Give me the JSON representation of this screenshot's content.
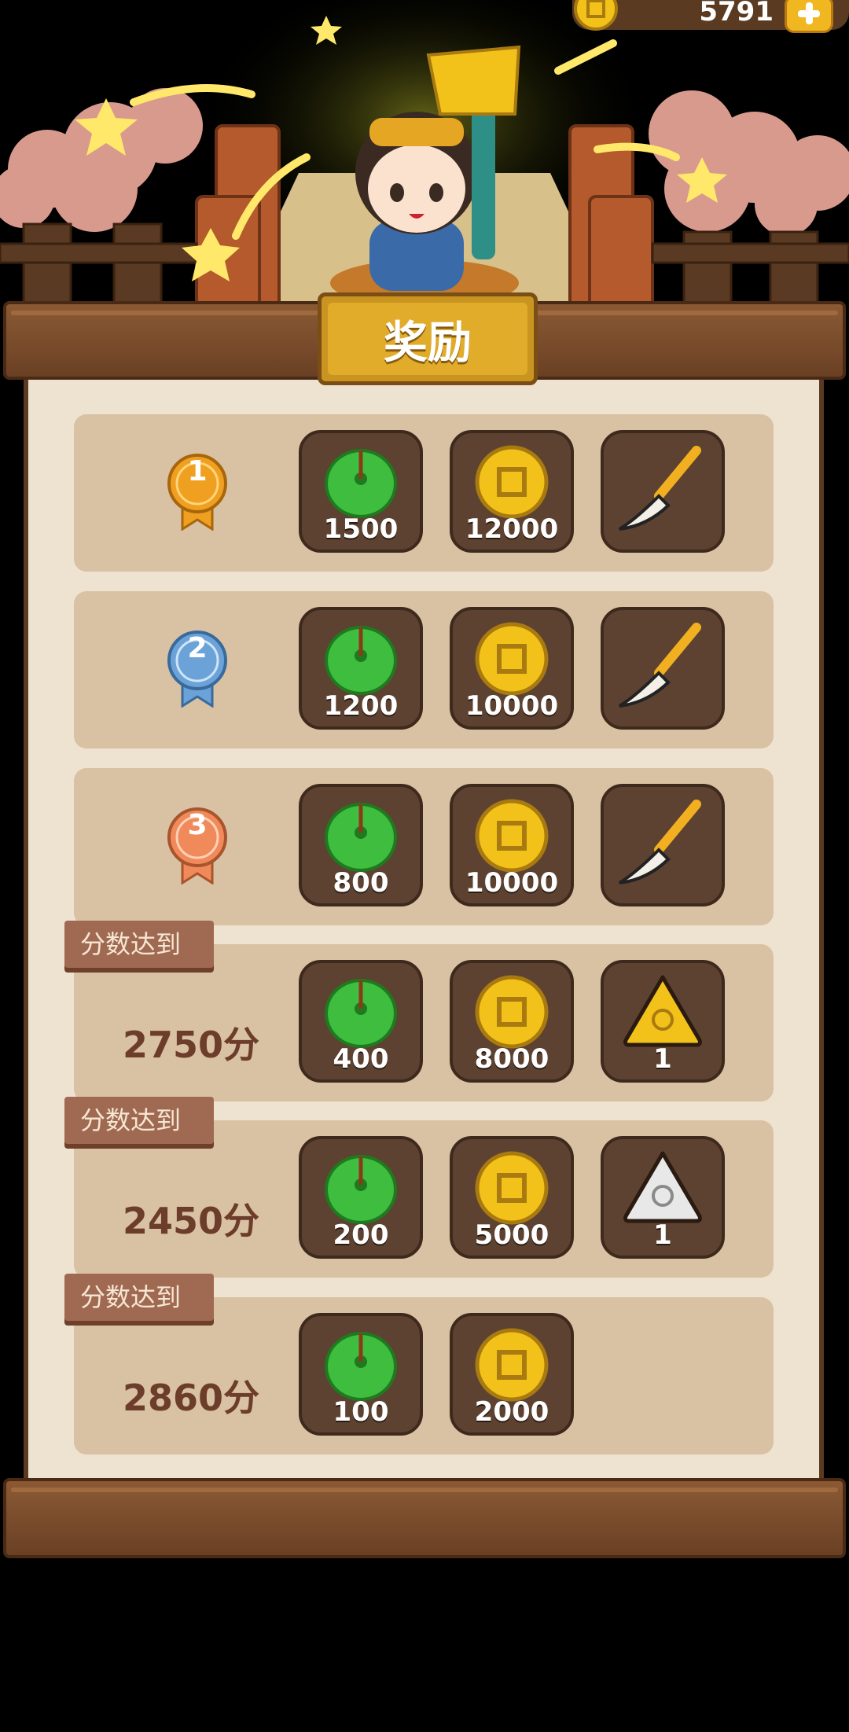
{
  "currency": {
    "amount": "5791"
  },
  "panel": {
    "title": "奖励"
  },
  "icons": {
    "jade": "green-jade-disc-icon",
    "coin": "gold-coin-icon",
    "brush": "calligraphy-brush-icon",
    "gold_talisman": "gold-triangle-talisman-icon",
    "silver_talisman": "silver-triangle-talisman-icon"
  },
  "rank_rows": [
    {
      "rank": "1",
      "medal_color": "#f0a020",
      "jade": "1500",
      "coin": "12000",
      "brush": ""
    },
    {
      "rank": "2",
      "medal_color": "#6ba3d8",
      "jade": "1200",
      "coin": "10000",
      "brush": ""
    },
    {
      "rank": "3",
      "medal_color": "#f08a5a",
      "jade": "800",
      "coin": "10000",
      "brush": ""
    }
  ],
  "score_rows": [
    {
      "label": "分数达到",
      "score": "2750分",
      "jade": "400",
      "coin": "8000",
      "talisman": "1"
    },
    {
      "label": "分数达到",
      "score": "2450分",
      "jade": "200",
      "coin": "5000",
      "talisman": "1"
    },
    {
      "label": "分数达到",
      "score": "2860分",
      "jade": "100",
      "coin": "2000"
    }
  ]
}
